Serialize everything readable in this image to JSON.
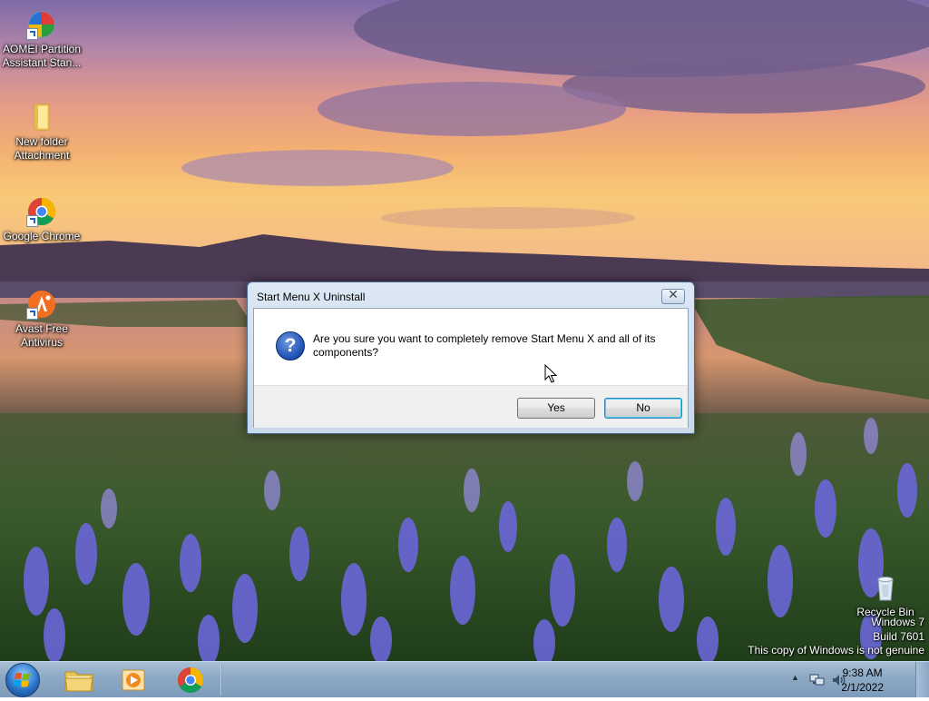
{
  "desktop": {
    "icons": [
      {
        "label_line1": "AOMEI Partition",
        "label_line2": "Assistant Stan...",
        "icon": "aomei-icon"
      },
      {
        "label_line1": "New folder",
        "label_line2": "Attachment",
        "icon": "folder-icon"
      },
      {
        "label_line1": "Google Chrome",
        "label_line2": "",
        "icon": "chrome-icon"
      },
      {
        "label_line1": "Avast Free",
        "label_line2": "Antivirus",
        "icon": "avast-icon"
      },
      {
        "label_line1": "Recycle Bin",
        "label_line2": "",
        "icon": "recycle-bin-icon"
      }
    ],
    "watermark": {
      "line1": "Windows 7",
      "line2": "Build 7601",
      "line3": "This copy of Windows is not genuine"
    }
  },
  "dialog": {
    "title": "Start Menu X Uninstall",
    "close_glyph": "✕",
    "icon": "question-icon",
    "icon_glyph": "?",
    "message": "Are you sure you want to completely remove Start Menu X and all of its components?",
    "buttons": {
      "yes": "Yes",
      "no": "No"
    }
  },
  "taskbar": {
    "start": "windows-start-icon",
    "pinned": [
      "file-explorer-icon",
      "media-player-icon",
      "chrome-icon"
    ],
    "tray": {
      "overflow_glyph": "▲",
      "icons": [
        "network-icon",
        "volume-icon"
      ],
      "time": "9:38 AM",
      "date": "2/1/2022"
    }
  },
  "colors": {
    "taskbar": "#8eaac6",
    "dialog_frame": "#c9d9ea",
    "default_button_border": "#3c7fb1"
  }
}
